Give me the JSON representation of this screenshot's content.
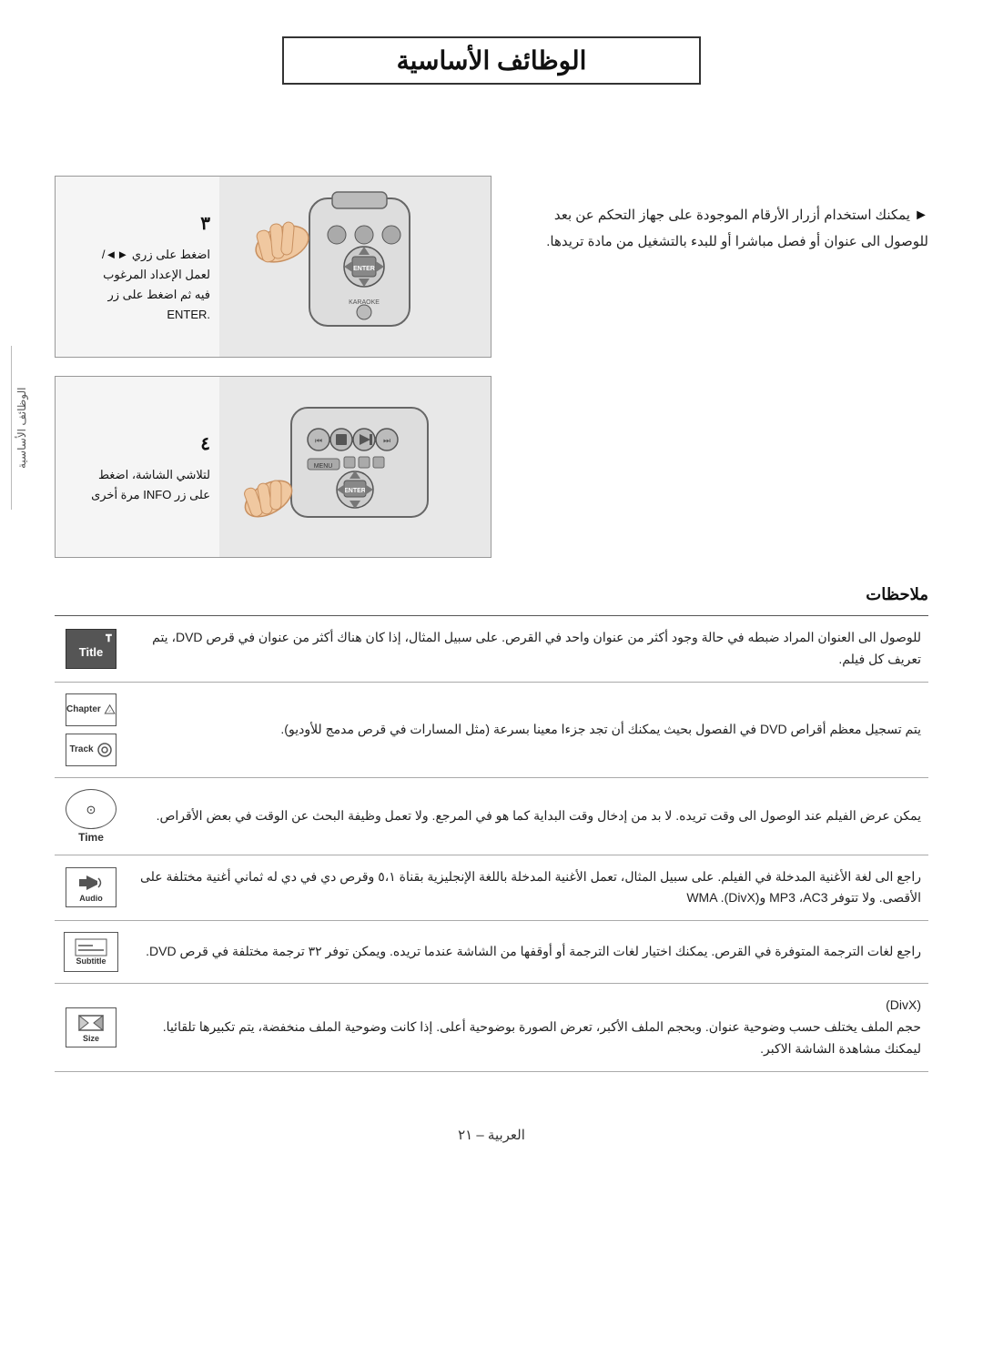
{
  "page": {
    "title": "الوظائف الأساسية",
    "footer": "العربية – ٢١"
  },
  "top_section": {
    "left_text": {
      "bullet": "►",
      "content": "يمكنك استخدام أزرار الأرقام الموجودة على جهاز التحكم عن بعد للوصول الى عنوان أو فصل مباشرا أو للبدء بالتشغيل من مادة تريدها."
    },
    "step3": {
      "number": "٣",
      "line1": "اضغط على زري ►◄/",
      "line2": "لعمل الإعداد المرغوب",
      "line3": "فيه ثم اضغط على زر",
      "line4": ".ENTER"
    },
    "step4": {
      "number": "٤",
      "line1": "لتلاشي الشاشة، اضغط",
      "line2": "على زر INFO مرة أخرى"
    }
  },
  "notes": {
    "title": "ملاحظات",
    "rows": [
      {
        "id": "title",
        "icon_top": "𝐓",
        "icon_label": "Title",
        "icon_type": "square_dark",
        "text": "للوصول الى العنوان المراد ضبطه في حالة وجود أكثر من عنوان واحد في القرص. على سبيل المثال، إذا كان هناك أكثر من عنوان في قرص DVD، يتم تعريف كل فيلم."
      },
      {
        "id": "chapter_track",
        "icon_top": "Chapter",
        "icon_label": "Chapter",
        "icon_label2": "Track",
        "icon_type": "chapter_track",
        "text": "يتم تسجيل معظم أقراص DVD في الفصول بحيث يمكنك أن تجد جزءا معينا بسرعة (مثل المسارات في قرص مدمج للأوديو)."
      },
      {
        "id": "time",
        "icon_top": "⊙",
        "icon_label": "Time",
        "icon_type": "circle_time",
        "text": "يمكن عرض الفيلم عند الوصول الى وقت تريده. لا بد من إدخال وقت البداية كما هو في المرجع. ولا تعمل وظيفة البحث عن الوقت في بعض الأقراص."
      },
      {
        "id": "audio",
        "icon_top": "🎵",
        "icon_label": "Audio",
        "icon_type": "square_audio",
        "text": "راجع الى لغة الأغنية المدخلة في الفيلم. على سبيل المثال، تعمل الأغنية المدخلة باللغة الإنجليزية بقناة ٥،١ وقرص دي في دي له ثماني أغنية مختلفة على الأقصى. ولا تتوفر MP3 ،AC3 وWMA .(DivX)"
      },
      {
        "id": "subtitle",
        "icon_top": "Sub",
        "icon_label": "Subtitle",
        "icon_type": "square_subtitle",
        "text": "راجع لغات الترجمة المتوفرة في القرص. يمكنك اختيار لغات الترجمة أو أوقفها من الشاشة عندما تريده. ويمكن توفر ٣٢ ترجمة مختلفة في قرص DVD."
      },
      {
        "id": "size",
        "icon_top": "☐",
        "icon_label": "Size",
        "icon_type": "square_size",
        "text": "(DivX)\nحجم الملف يختلف حسب وضوحية عنوان. وبحجم الملف الأكبر، تعرض الصورة بوضوحية أعلى. إذا كانت وضوحية الملف منخفضة، يتم تكبيرها تلقائيا. ليمكنك مشاهدة الشاشة الاكبر."
      }
    ]
  },
  "sidebar_label": "الوظائف الأساسية"
}
